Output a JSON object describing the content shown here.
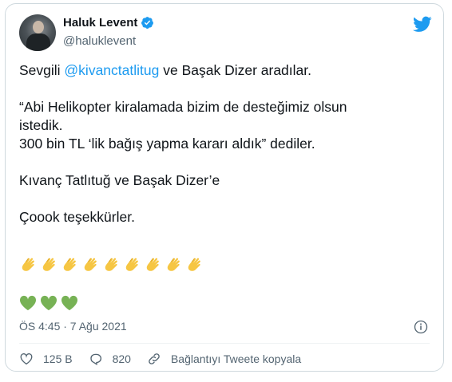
{
  "author": {
    "name": "Haluk Levent",
    "handle": "@haluklevent",
    "verified": true
  },
  "tweet": {
    "line1_prefix": "Sevgili ",
    "mention": "@kivanctatlitug",
    "line1_suffix": " ve Başak Dizer aradılar.",
    "para2_line1": "“Abi Helikopter kiralamada bizim de desteğimiz olsun",
    "para2_line2": "istedik.",
    "para2_line3": "300 bin TL ‘lik bağış yapma kararı aldık” dediler.",
    "para3": "Kıvanç Tatlıtuğ ve Başak Dizer’e",
    "para4": "Çoook teşekkürler.",
    "emoji_claps": "👏👏👏👏👏👏👏👏👏",
    "emoji_hearts": "💚💚💚"
  },
  "timestamp": "ÖS 4:45 · 7 Ağu 2021",
  "actions": {
    "likes": "125 B",
    "replies": "820",
    "copy_link": "Bağlantıyı Tweete kopyala"
  },
  "colors": {
    "accent": "#1d9bf0",
    "text": "#0f1419",
    "muted": "#536471",
    "heart_green": "#77b255",
    "clap_yellow": "#f6c643"
  },
  "icons": [
    "verified-badge-icon",
    "twitter-bird-icon",
    "info-icon",
    "heart-icon",
    "reply-icon",
    "link-icon"
  ]
}
